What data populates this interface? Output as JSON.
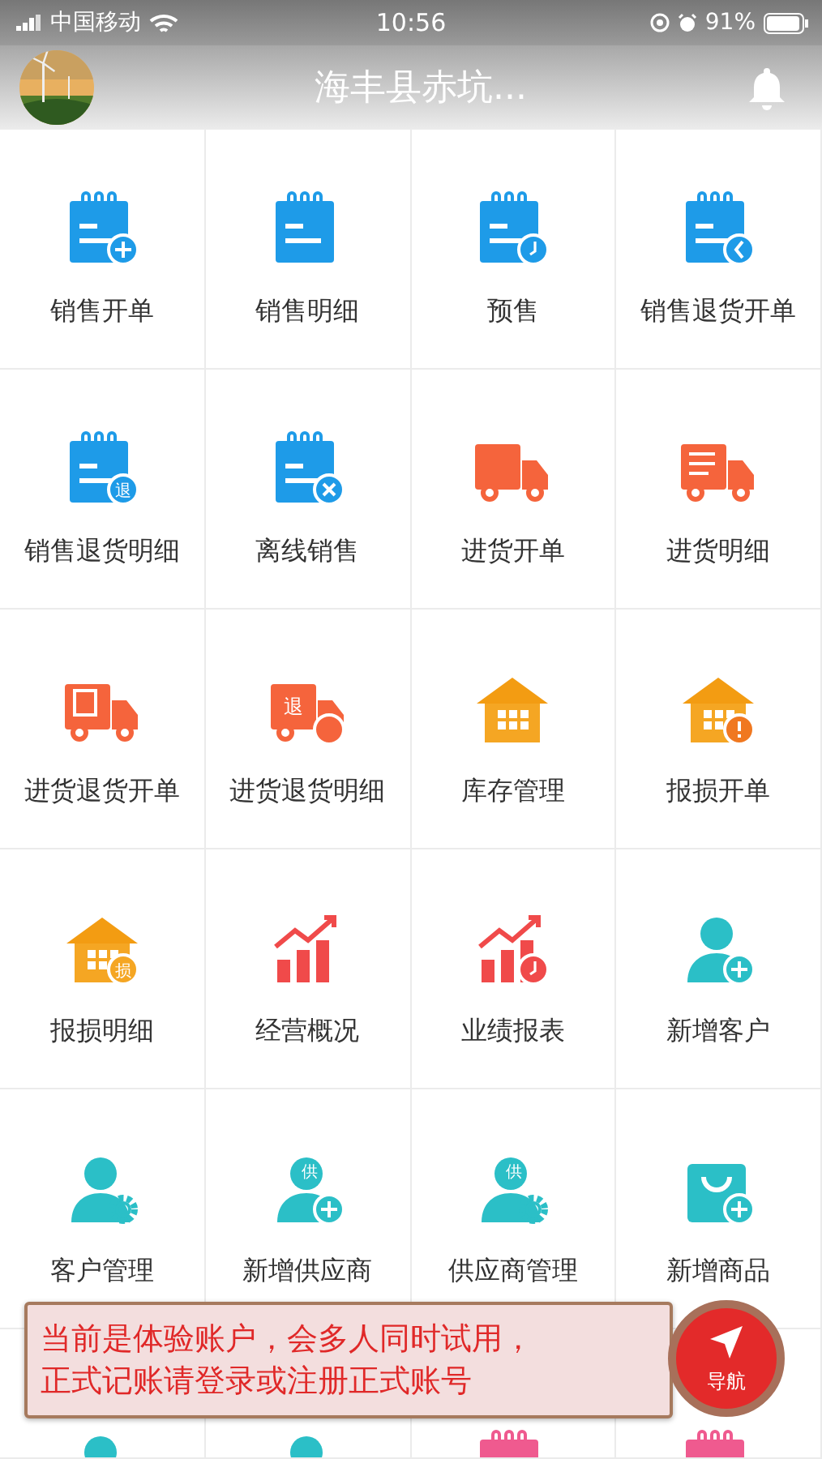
{
  "status_bar": {
    "carrier": "中国移动",
    "time": "10:56",
    "battery": "91%"
  },
  "header": {
    "title": "海丰县赤坑..."
  },
  "grid": [
    {
      "label": "销售开单",
      "kind": "doc-plus",
      "color": "#1e9be8"
    },
    {
      "label": "销售明细",
      "kind": "doc-none",
      "color": "#1e9be8"
    },
    {
      "label": "预售",
      "kind": "doc-clock",
      "color": "#1e9be8"
    },
    {
      "label": "销售退货开单",
      "kind": "doc-back",
      "color": "#1e9be8"
    },
    {
      "label": "销售退货明细",
      "kind": "doc-text",
      "badge_text": "退",
      "color": "#1e9be8"
    },
    {
      "label": "离线销售",
      "kind": "doc-x",
      "color": "#1e9be8"
    },
    {
      "label": "进货开单",
      "kind": "truck-none",
      "color": "#f5643c"
    },
    {
      "label": "进货明细",
      "kind": "truck-lines",
      "color": "#f5643c"
    },
    {
      "label": "进货退货开单",
      "kind": "truck-doc",
      "color": "#f5643c"
    },
    {
      "label": "进货退货明细",
      "kind": "truck-text",
      "badge_text": "退",
      "color": "#f5643c"
    },
    {
      "label": "库存管理",
      "kind": "house-none",
      "color": "#f5a623"
    },
    {
      "label": "报损开单",
      "kind": "house-alert",
      "color": "#f5a623"
    },
    {
      "label": "报损明细",
      "kind": "house-text",
      "badge_text": "损",
      "color": "#f5a623"
    },
    {
      "label": "经营概况",
      "kind": "chart-none",
      "color": "#f04a4a"
    },
    {
      "label": "业绩报表",
      "kind": "chart-clock",
      "color": "#f04a4a"
    },
    {
      "label": "新增客户",
      "kind": "person-plus",
      "color": "#2bbfc7"
    },
    {
      "label": "客户管理",
      "kind": "person-gear",
      "color": "#2bbfc7"
    },
    {
      "label": "新增供应商",
      "kind": "person-plus",
      "badge_text": "供",
      "color": "#2bbfc7"
    },
    {
      "label": "供应商管理",
      "kind": "person-gear",
      "badge_text": "供",
      "color": "#2bbfc7"
    },
    {
      "label": "新增商品",
      "kind": "bag-plus",
      "color": "#2bbfc7"
    },
    {
      "kind": "person-none",
      "color": "#2bbfc7"
    },
    {
      "kind": "person-none",
      "color": "#2bbfc7"
    },
    {
      "kind": "doc-none",
      "color": "#ef5a8f"
    },
    {
      "kind": "doc-none",
      "color": "#ef5a8f"
    }
  ],
  "notice": {
    "lines": [
      "当前是体验账户，会多人同时试用，",
      "正式记账请登录或注册正式账号"
    ]
  },
  "nav_button": {
    "label": "导航"
  }
}
